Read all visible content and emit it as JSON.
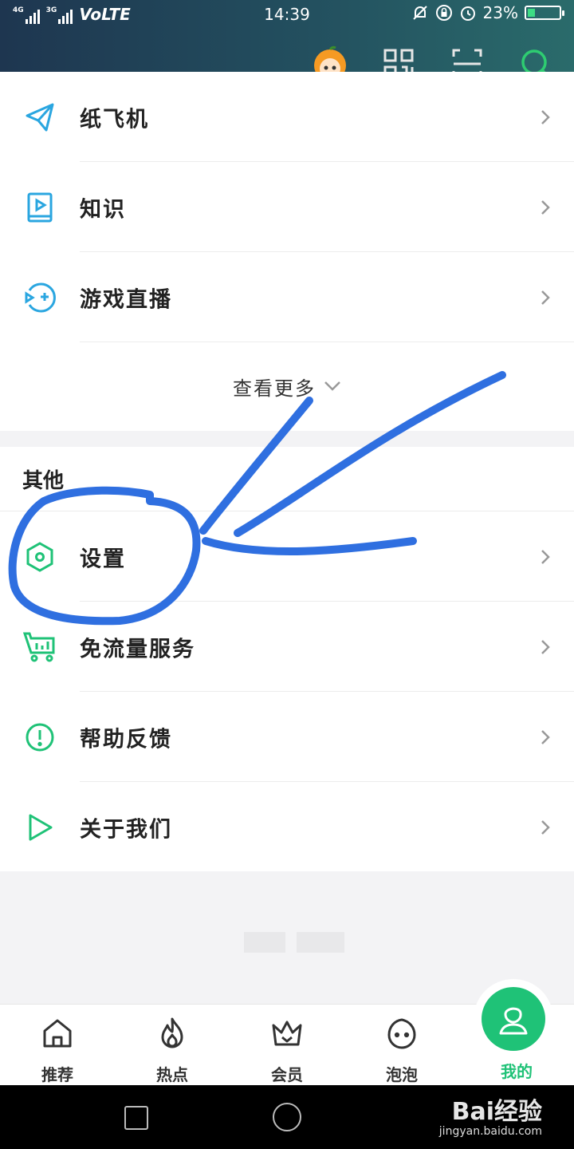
{
  "status_bar": {
    "network_1": "4G",
    "network_2": "3G",
    "carrier": "VoLTE",
    "time": "14:39",
    "battery": "23%",
    "battery_level": 0.23
  },
  "header_icons": [
    "avatar-icon",
    "qr-code-icon",
    "scan-icon",
    "search-icon"
  ],
  "list_top": [
    {
      "label": "纸飞机",
      "icon": "paper-plane-icon"
    },
    {
      "label": "知识",
      "icon": "book-play-icon"
    },
    {
      "label": "游戏直播",
      "icon": "game-live-icon"
    }
  ],
  "see_more": "查看更多",
  "section_other": {
    "title": "其他",
    "items": [
      {
        "label": "设置",
        "icon": "settings-hex-icon"
      },
      {
        "label": "免流量服务",
        "icon": "cart-icon"
      },
      {
        "label": "帮助反馈",
        "icon": "exclamation-circle-icon"
      },
      {
        "label": "关于我们",
        "icon": "play-triangle-icon"
      }
    ]
  },
  "tabs": [
    {
      "label": "推荐",
      "icon": "home-icon"
    },
    {
      "label": "热点",
      "icon": "flame-icon"
    },
    {
      "label": "会员",
      "icon": "crown-icon"
    },
    {
      "label": "泡泡",
      "icon": "bubble-face-icon"
    },
    {
      "label": "我的",
      "icon": "profile-icon",
      "active": true
    }
  ],
  "watermark": {
    "brand": "Bai经验",
    "url": "jingyan.baidu.com"
  },
  "colors": {
    "accent": "#1fc277",
    "icon_blue": "#2aa6e0",
    "annotation": "#2f6fe0"
  }
}
